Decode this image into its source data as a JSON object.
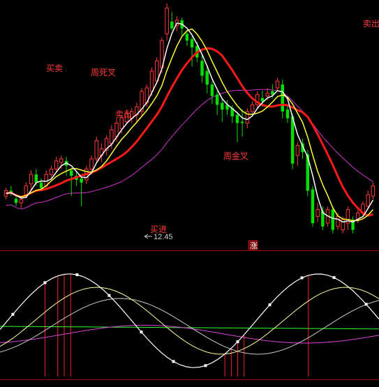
{
  "colors": {
    "background": "#000000",
    "up_candle": "#ff3a3a",
    "down_candle": "#00e000",
    "ma_short": "#ffffff",
    "ma_mid": "#ffff33",
    "ma_long": "#ff1a1a",
    "ma_extra": "#cc33cc",
    "divider": "#a01010",
    "osc_white": "#ffffff",
    "osc_yellow": "#ffff99",
    "osc_green": "#33ff33",
    "osc_magenta": "#dd44dd",
    "osc_gray": "#cccccc",
    "signal_bar": "#ff2020",
    "annotation": "#ff3a3a"
  },
  "annotations": [
    {
      "id": "a1",
      "text": "买卖"
    },
    {
      "id": "a2",
      "text": "周死叉"
    },
    {
      "id": "a3",
      "text": "卖出"
    },
    {
      "id": "a4",
      "text": "买进"
    },
    {
      "id": "a5",
      "text": "周金叉"
    },
    {
      "id": "a6",
      "text": "卖出"
    }
  ],
  "price_label": "12.45",
  "zhang_badge": "涨",
  "chart_data": [
    {
      "type": "candlestick",
      "title": "",
      "note": "Main price panel: candlesticks with moving averages; price axis not labeled except the low marker.",
      "min_price_label": 12.45,
      "series": [
        {
          "name": "",
          "color": "#ffffff",
          "kind": "line"
        },
        {
          "name": "",
          "color": "#ffff33",
          "kind": "line"
        },
        {
          "name": "",
          "color": "#ff1a1a",
          "kind": "line"
        },
        {
          "name": "",
          "color": "#cc33cc",
          "kind": "line"
        }
      ],
      "candles": [
        {
          "o": 40,
          "c": 48,
          "h": 35,
          "l": 52
        },
        {
          "o": 48,
          "c": 44,
          "h": 40,
          "l": 55
        },
        {
          "o": 36,
          "c": 30,
          "h": 25,
          "l": 42
        },
        {
          "o": 30,
          "c": 35,
          "h": 22,
          "l": 40
        },
        {
          "o": 42,
          "c": 55,
          "h": 38,
          "l": 60
        },
        {
          "o": 58,
          "c": 72,
          "h": 50,
          "l": 78
        },
        {
          "o": 72,
          "c": 60,
          "h": 55,
          "l": 80
        },
        {
          "o": 60,
          "c": 52,
          "h": 48,
          "l": 66
        },
        {
          "o": 55,
          "c": 72,
          "h": 50,
          "l": 78
        },
        {
          "o": 72,
          "c": 80,
          "h": 65,
          "l": 85
        },
        {
          "o": 80,
          "c": 92,
          "h": 75,
          "l": 98
        },
        {
          "o": 90,
          "c": 95,
          "h": 80,
          "l": 100
        },
        {
          "o": 92,
          "c": 85,
          "h": 70,
          "l": 98
        },
        {
          "o": 78,
          "c": 70,
          "h": 40,
          "l": 82
        },
        {
          "o": 70,
          "c": 64,
          "h": 55,
          "l": 75
        },
        {
          "o": 66,
          "c": 60,
          "h": 25,
          "l": 70
        },
        {
          "o": 64,
          "c": 80,
          "h": 58,
          "l": 85
        },
        {
          "o": 80,
          "c": 95,
          "h": 72,
          "l": 100
        },
        {
          "o": 95,
          "c": 122,
          "h": 88,
          "l": 128
        },
        {
          "o": 100,
          "c": 110,
          "h": 90,
          "l": 118
        },
        {
          "o": 108,
          "c": 125,
          "h": 100,
          "l": 130
        },
        {
          "o": 118,
          "c": 138,
          "h": 110,
          "l": 145
        },
        {
          "o": 128,
          "c": 148,
          "h": 120,
          "l": 155
        },
        {
          "o": 140,
          "c": 156,
          "h": 132,
          "l": 160
        },
        {
          "o": 150,
          "c": 162,
          "h": 146,
          "l": 168
        },
        {
          "o": 155,
          "c": 165,
          "h": 148,
          "l": 170
        },
        {
          "o": 160,
          "c": 172,
          "h": 150,
          "l": 178
        },
        {
          "o": 165,
          "c": 195,
          "h": 158,
          "l": 200
        },
        {
          "o": 178,
          "c": 200,
          "h": 172,
          "l": 205
        },
        {
          "o": 195,
          "c": 225,
          "h": 188,
          "l": 230
        },
        {
          "o": 210,
          "c": 240,
          "h": 205,
          "l": 245
        },
        {
          "o": 230,
          "c": 270,
          "h": 222,
          "l": 275
        },
        {
          "o": 280,
          "c": 318,
          "h": 270,
          "l": 325
        },
        {
          "o": 298,
          "c": 288,
          "h": 285,
          "l": 312
        },
        {
          "o": 292,
          "c": 300,
          "h": 284,
          "l": 306
        },
        {
          "o": 300,
          "c": 288,
          "h": 278,
          "l": 304
        },
        {
          "o": 280,
          "c": 270,
          "h": 262,
          "l": 284
        },
        {
          "o": 272,
          "c": 260,
          "h": 232,
          "l": 276
        },
        {
          "o": 262,
          "c": 245,
          "h": 238,
          "l": 268
        },
        {
          "o": 240,
          "c": 218,
          "h": 208,
          "l": 250
        },
        {
          "o": 225,
          "c": 205,
          "h": 192,
          "l": 232
        },
        {
          "o": 205,
          "c": 188,
          "h": 176,
          "l": 210
        },
        {
          "o": 190,
          "c": 175,
          "h": 160,
          "l": 195
        },
        {
          "o": 178,
          "c": 168,
          "h": 150,
          "l": 185
        },
        {
          "o": 175,
          "c": 168,
          "h": 160,
          "l": 182
        },
        {
          "o": 170,
          "c": 158,
          "h": 148,
          "l": 174
        },
        {
          "o": 160,
          "c": 148,
          "h": 120,
          "l": 165
        },
        {
          "o": 150,
          "c": 148,
          "h": 128,
          "l": 168
        },
        {
          "o": 148,
          "c": 165,
          "h": 140,
          "l": 170
        },
        {
          "o": 165,
          "c": 175,
          "h": 160,
          "l": 180
        },
        {
          "o": 175,
          "c": 190,
          "h": 170,
          "l": 195
        },
        {
          "o": 185,
          "c": 180,
          "h": 172,
          "l": 196
        },
        {
          "o": 188,
          "c": 192,
          "h": 182,
          "l": 200
        },
        {
          "o": 195,
          "c": 190,
          "h": 185,
          "l": 205
        },
        {
          "o": 200,
          "c": 210,
          "h": 195,
          "l": 215
        },
        {
          "o": 205,
          "c": 165,
          "h": 155,
          "l": 212
        },
        {
          "o": 168,
          "c": 155,
          "h": 148,
          "l": 175
        },
        {
          "o": 158,
          "c": 88,
          "h": 80,
          "l": 162
        },
        {
          "o": 100,
          "c": 115,
          "h": 85,
          "l": 120
        },
        {
          "o": 118,
          "c": 105,
          "h": 95,
          "l": 125
        },
        {
          "o": 102,
          "c": 48,
          "h": 40,
          "l": 108
        },
        {
          "o": 50,
          "c": 0,
          "h": -5,
          "l": 55
        },
        {
          "o": 10,
          "c": 20,
          "h": 2,
          "l": 30
        },
        {
          "o": 18,
          "c": -5,
          "h": -10,
          "l": 25
        },
        {
          "o": 0,
          "c": 20,
          "h": -5,
          "l": 25
        },
        {
          "o": 20,
          "c": -10,
          "h": -15,
          "l": 25
        },
        {
          "o": -5,
          "c": 10,
          "h": -10,
          "l": 15
        },
        {
          "o": -10,
          "c": 5,
          "h": -15,
          "l": 10
        },
        {
          "o": 0,
          "c": 20,
          "h": -10,
          "l": 25
        },
        {
          "o": 5,
          "c": -10,
          "h": -15,
          "l": 10
        },
        {
          "o": 5,
          "c": 15,
          "h": 0,
          "l": 20
        },
        {
          "o": 15,
          "c": 28,
          "h": 10,
          "l": 32
        },
        {
          "o": 25,
          "c": 42,
          "h": 20,
          "l": 48
        },
        {
          "o": 40,
          "c": 55,
          "h": 35,
          "l": 60
        }
      ]
    },
    {
      "type": "line",
      "title": "",
      "note": "Oscillator sub-panel with several indicator lines and red signal bars.",
      "series": [
        {
          "name": "",
          "color": "#ffffff"
        },
        {
          "name": "",
          "color": "#ffff99"
        },
        {
          "name": "",
          "color": "#33ff33"
        },
        {
          "name": "",
          "color": "#dd44dd"
        },
        {
          "name": "",
          "color": "#cccccc"
        }
      ]
    }
  ]
}
